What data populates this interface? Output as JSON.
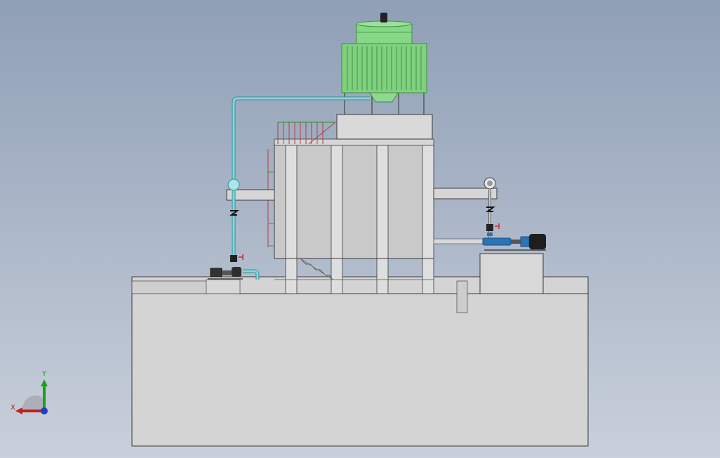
{
  "viewport": {
    "background_top": "#8f9fb6",
    "background_bottom": "#c9d0db"
  },
  "colors": {
    "concrete": "#d4d4d4",
    "concrete_shade": "#bdbdbd",
    "tower_green": "#7fd07f",
    "tower_green_dark": "#3f8f3f",
    "pipe_cyan": "#86d8e0",
    "pipe_grey": "#c8c8c8",
    "pump_blue": "#2a74b8",
    "valve_red": "#c03030",
    "railing_red": "#b04040",
    "railing_green": "#3c9a3c",
    "outline": "#3a3a3a"
  },
  "triad": {
    "y_label": "Y",
    "x_label": "X",
    "y_color": "#1ca01c",
    "x_color": "#c02020",
    "z_color": "#2040c0",
    "icons": [
      "y-axis-arrow",
      "x-axis-arrow",
      "z-axis-dot"
    ]
  }
}
